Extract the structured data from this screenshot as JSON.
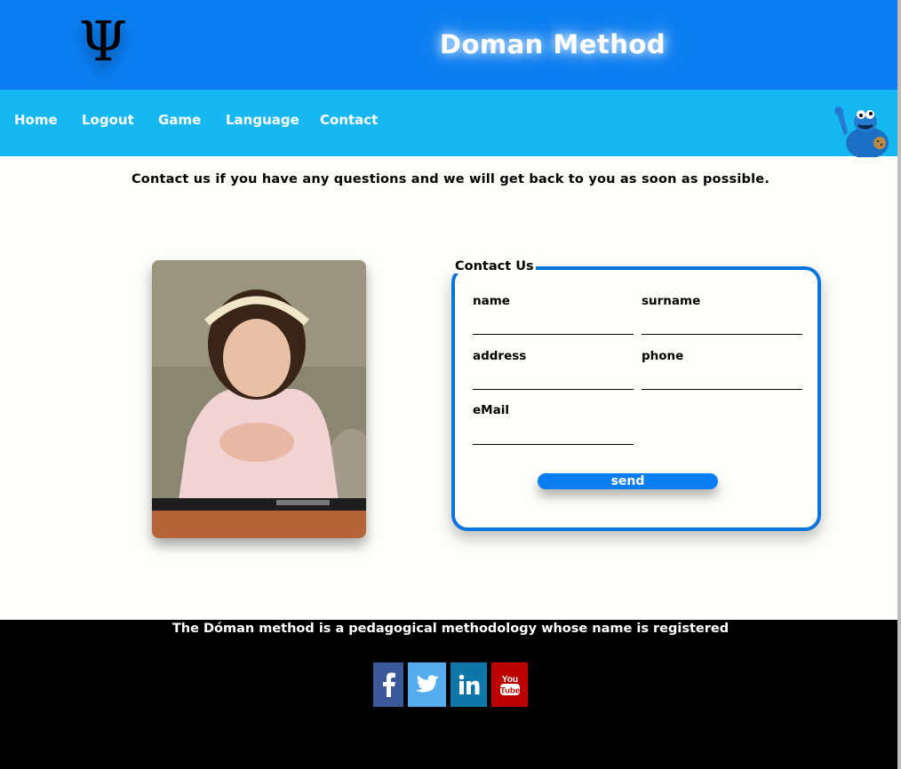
{
  "header": {
    "logo_glyph": "Ψ",
    "title": "Doman Method"
  },
  "nav": {
    "items": [
      "Home",
      "Logout",
      "Game",
      "Language",
      "Contact"
    ]
  },
  "intro": "Contact us if you have any questions and we will get back to you as soon as possible.",
  "form": {
    "legend": "Contact Us",
    "fields": {
      "name": "name",
      "surname": "surname",
      "address": "address",
      "phone": "phone",
      "email": "eMail"
    },
    "send_label": "send"
  },
  "footer": {
    "text": "The Dóman method is a pedagogical methodology whose name is registered"
  },
  "social": {
    "facebook_color": "#3b5998",
    "twitter_color": "#55acee",
    "linkedin_color": "#0e76a8",
    "youtube_color": "#bb0000"
  },
  "colors": {
    "header_bg": "#0a7df0",
    "nav_bg": "#17b8f2",
    "form_border": "#0a74dd",
    "footer_bg": "#000000"
  }
}
